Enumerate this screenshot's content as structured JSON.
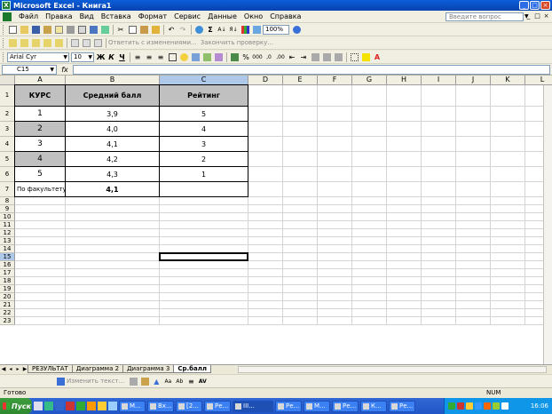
{
  "window": {
    "title": "Microsoft Excel - Книга1"
  },
  "menu": {
    "items": [
      "Файл",
      "Правка",
      "Вид",
      "Вставка",
      "Формат",
      "Сервис",
      "Данные",
      "Окно",
      "Справка"
    ],
    "help_placeholder": "Введите вопрос"
  },
  "toolbar_standard": {
    "zoom": "100%"
  },
  "toolbar_review": {
    "reply_text": "Ответить с изменениями...",
    "end_review": "Закончить проверку..."
  },
  "toolbar_formatting": {
    "font": "Arial Cyr",
    "size": "10",
    "bold": "Ж",
    "italic": "К",
    "underline": "Ч",
    "percent": "%",
    "thousands": "000"
  },
  "formula_bar": {
    "name_box": "C15",
    "fx": "fx",
    "formula": ""
  },
  "columns": [
    "A",
    "B",
    "C",
    "D",
    "E",
    "F",
    "G",
    "H",
    "I",
    "J",
    "K",
    "L"
  ],
  "rows": [
    "1",
    "2",
    "3",
    "4",
    "5",
    "6",
    "7",
    "8",
    "9",
    "10",
    "11",
    "12",
    "13",
    "14",
    "15",
    "16",
    "17",
    "18",
    "19",
    "20",
    "21",
    "22",
    "23"
  ],
  "table": {
    "headers": [
      "КУРС",
      "Средний балл",
      "Рейтинг"
    ],
    "data": [
      {
        "course": "1",
        "avg": "3,9",
        "rating": "5"
      },
      {
        "course": "2",
        "avg": "4,0",
        "rating": "4"
      },
      {
        "course": "3",
        "avg": "4,1",
        "rating": "3"
      },
      {
        "course": "4",
        "avg": "4,2",
        "rating": "2"
      },
      {
        "course": "5",
        "avg": "4,3",
        "rating": "1"
      }
    ],
    "footer_label": "По факультету",
    "footer_value": "4,1"
  },
  "sheet_tabs": [
    "РЕЗУЛЬТАТ",
    "Диаграмма 2",
    "Диаграмма 3",
    "Ср.балл"
  ],
  "active_sheet": "Ср.балл",
  "drawing_toolbar": {
    "wordart_text": "Изменить текст..."
  },
  "status": {
    "ready": "Готово",
    "num": "NUM"
  },
  "taskbar": {
    "start": "Пуск",
    "buttons": [
      "М...",
      "Вх...",
      "[2...",
      "Ре...",
      "III...",
      "Ре...",
      "М...",
      "Ре...",
      "К...",
      "Ре..."
    ],
    "clock": "16:06"
  },
  "colors": {
    "title_bar": "#0842b0",
    "selected_header": "#aec8ea",
    "gray_fill": "#c0c0c0",
    "taskbar": "#2056c7"
  }
}
